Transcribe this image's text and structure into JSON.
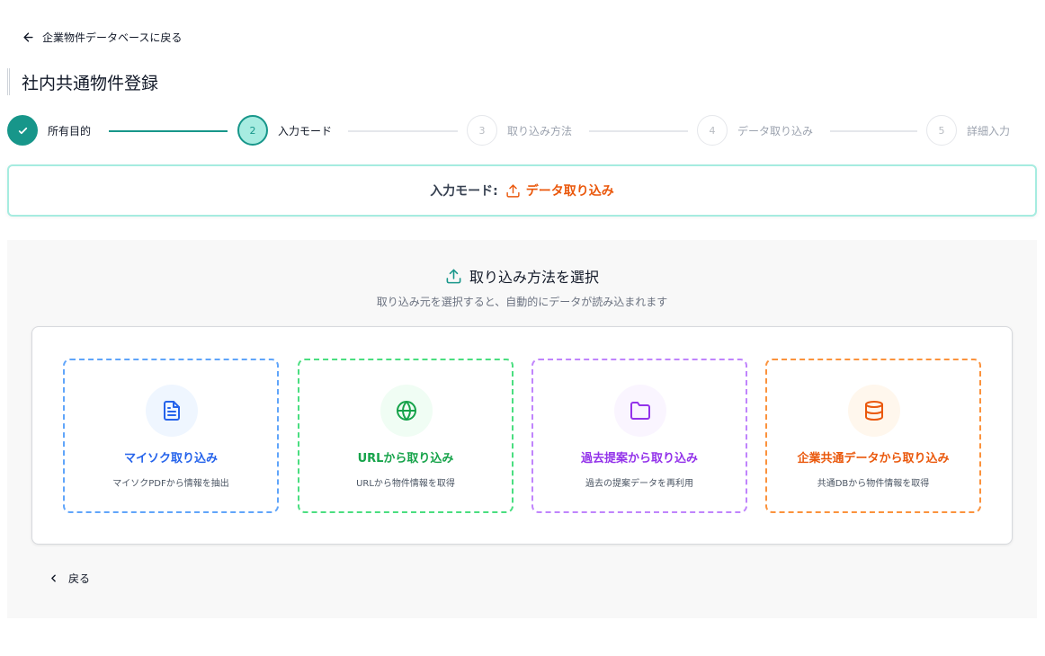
{
  "nav": {
    "back_label": "企業物件データベースに戻る"
  },
  "page": {
    "title": "社内共通物件登録"
  },
  "stepper": {
    "steps": [
      {
        "number": "",
        "label": "所有目的",
        "state": "done"
      },
      {
        "number": "2",
        "label": "入力モード",
        "state": "current"
      },
      {
        "number": "3",
        "label": "取り込み方法",
        "state": "pending"
      },
      {
        "number": "4",
        "label": "データ取り込み",
        "state": "pending"
      },
      {
        "number": "5",
        "label": "詳細入力",
        "state": "pending"
      }
    ]
  },
  "mode": {
    "label": "入力モード:",
    "value": "データ取り込み",
    "icon": "upload-icon",
    "color": "#ea580c"
  },
  "method": {
    "heading": "取り込み方法を選択",
    "subheading": "取り込み元を選択すると、自動的にデータが読み込まれます",
    "cards": [
      {
        "title": "マイソク取り込み",
        "description": "マイソクPDFから情報を抽出",
        "icon": "file-text-icon",
        "color": "#2563eb",
        "border": "#60a5fa",
        "bg": "#eff6ff"
      },
      {
        "title": "URLから取り込み",
        "description": "URLから物件情報を取得",
        "icon": "globe-icon",
        "color": "#16a34a",
        "border": "#4ade80",
        "bg": "#f0fdf4"
      },
      {
        "title": "過去提案から取り込み",
        "description": "過去の提案データを再利用",
        "icon": "folder-icon",
        "color": "#9333ea",
        "border": "#c084fc",
        "bg": "#faf5ff"
      },
      {
        "title": "企業共通データから取り込み",
        "description": "共通DBから物件情報を取得",
        "icon": "database-icon",
        "color": "#ea580c",
        "border": "#fb923c",
        "bg": "#fff7ed"
      }
    ]
  },
  "footer": {
    "back_label": "戻る"
  },
  "colors": {
    "accent": "#17968a",
    "accent_light": "#a7ece1"
  }
}
